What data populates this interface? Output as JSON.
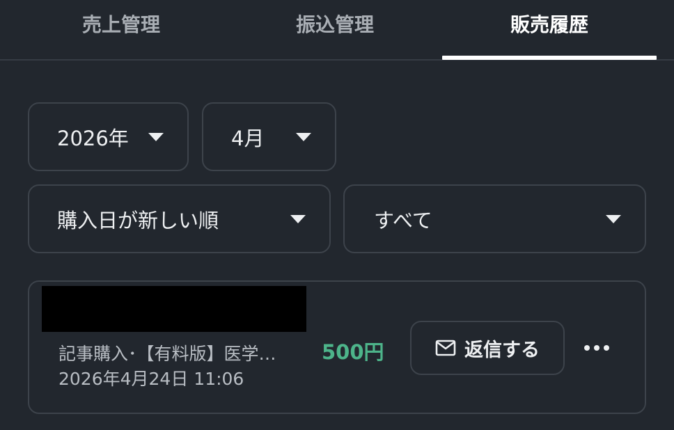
{
  "tabs": [
    {
      "label": "売上管理",
      "active": false
    },
    {
      "label": "振込管理",
      "active": false
    },
    {
      "label": "販売履歴",
      "active": true
    }
  ],
  "filters": {
    "year": "2026年",
    "month": "4月",
    "sort": "購入日が新しい順",
    "category": "すべて"
  },
  "sale": {
    "description": "記事購入･【有料版】医学…",
    "datetime": "2026年4月24日 11:06",
    "price": "500円",
    "reply_label": "返信する",
    "price_color": "#4db48a"
  },
  "icons": {
    "caret": "chevron-down-icon",
    "reply": "mail-icon",
    "more": "more-horizontal-icon"
  }
}
